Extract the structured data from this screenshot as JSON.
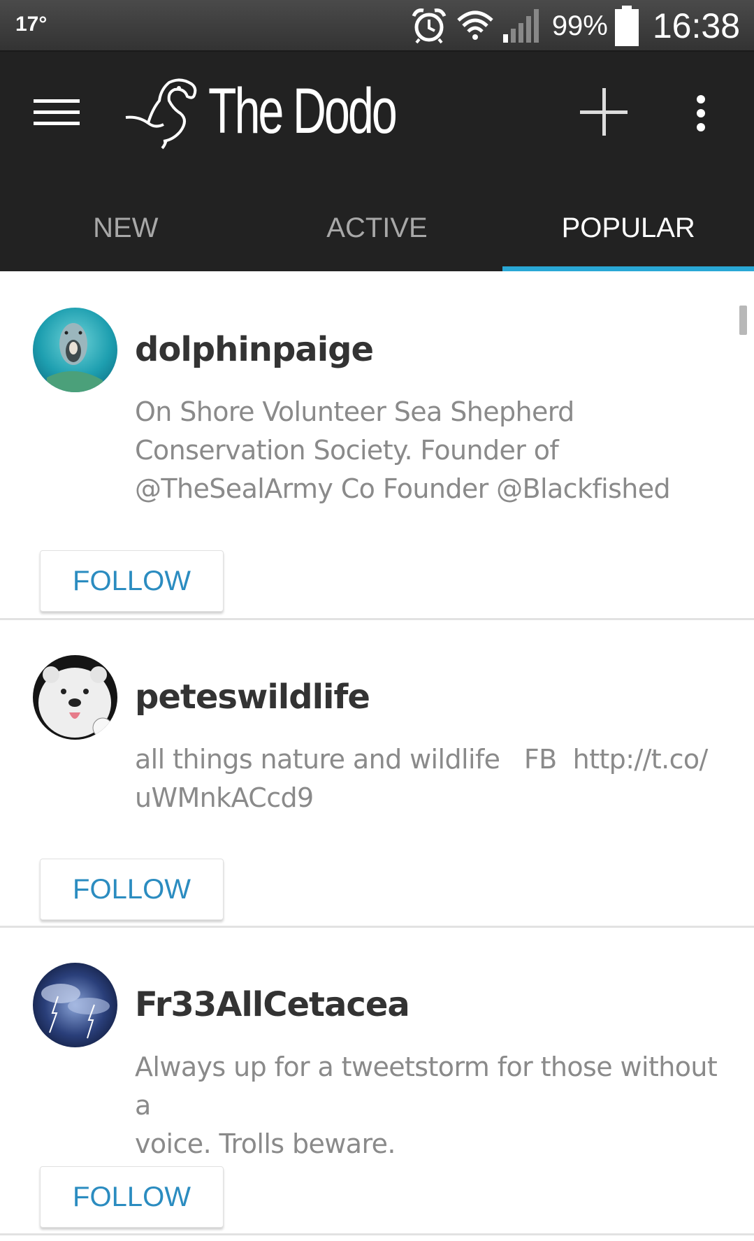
{
  "status_bar": {
    "temperature": "17°",
    "battery": "99%",
    "time": "16:38",
    "icons": [
      "alarm-icon",
      "wifi-icon",
      "signal-icon",
      "battery-icon"
    ]
  },
  "app_bar": {
    "brand": "The Dodo",
    "icons": [
      "menu-icon",
      "dodo-logo-icon",
      "add-icon",
      "more-vert-icon"
    ],
    "background": "#222222"
  },
  "tabs": [
    {
      "label": "NEW",
      "active": false
    },
    {
      "label": "ACTIVE",
      "active": false
    },
    {
      "label": "POPULAR",
      "active": true
    }
  ],
  "accent_color": "#2aa8d6",
  "users": [
    {
      "username": "dolphinpaige",
      "bio": "On Shore Volunteer Sea Shepherd\nConservation Society. Founder of\n@TheSealArmy Co Founder @Blackfished",
      "follow_label": "FOLLOW"
    },
    {
      "username": "peteswildlife",
      "bio": "all things nature and wildlife   FB  http://t.co/\nuWMnkACcd9",
      "follow_label": "FOLLOW"
    },
    {
      "username": "Fr33AllCetacea",
      "bio": "Always up for a tweetstorm for those without a\nvoice. Trolls beware.",
      "follow_label": "FOLLOW"
    }
  ]
}
